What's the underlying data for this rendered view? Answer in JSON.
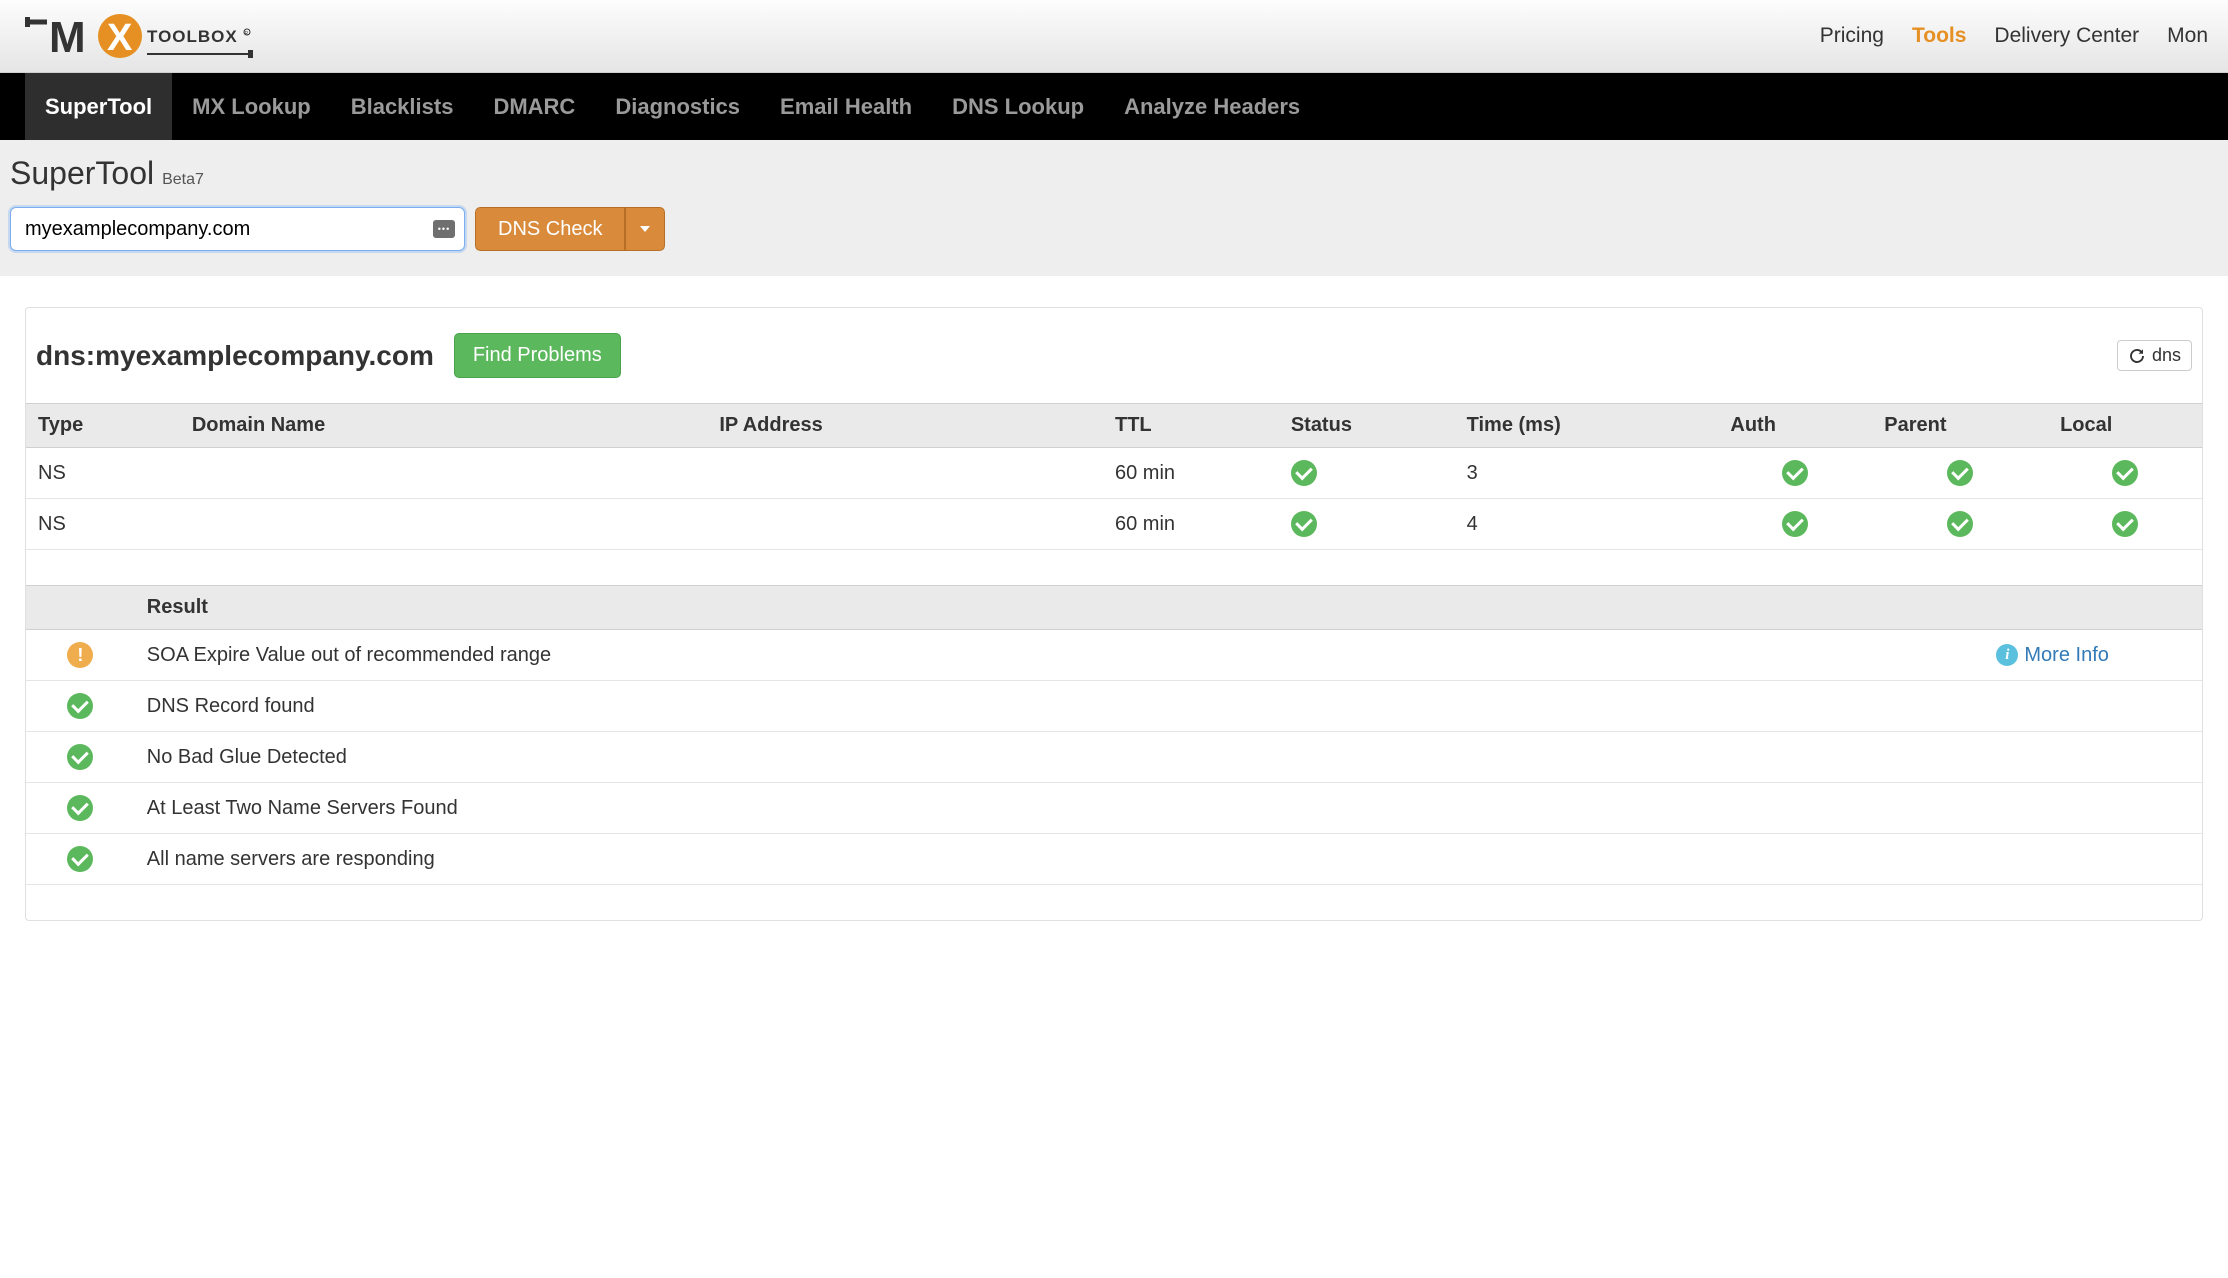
{
  "top_nav": {
    "pricing": "Pricing",
    "tools": "Tools",
    "delivery_center": "Delivery Center",
    "more": "Mon"
  },
  "black_nav": {
    "supertool": "SuperTool",
    "mx_lookup": "MX Lookup",
    "blacklists": "Blacklists",
    "dmarc": "DMARC",
    "diagnostics": "Diagnostics",
    "email_health": "Email Health",
    "dns_lookup": "DNS Lookup",
    "analyze_headers": "Analyze Headers"
  },
  "tool": {
    "title": "SuperTool",
    "beta": "Beta7",
    "input_value": "myexamplecompany.com",
    "action_label": "DNS Check"
  },
  "result": {
    "title": "dns:myexamplecompany.com",
    "find_problems": "Find Problems",
    "refresh_label": "dns"
  },
  "records_table": {
    "headers": {
      "type": "Type",
      "domain_name": "Domain Name",
      "ip": "IP Address",
      "ttl": "TTL",
      "status": "Status",
      "time": "Time (ms)",
      "auth": "Auth",
      "parent": "Parent",
      "local": "Local"
    },
    "rows": [
      {
        "type": "NS",
        "domain": "",
        "ip": "",
        "ttl": "60 min",
        "status": "ok",
        "time": "3",
        "auth": "ok",
        "parent": "ok",
        "local": "ok"
      },
      {
        "type": "NS",
        "domain": "",
        "ip": "",
        "ttl": "60 min",
        "status": "ok",
        "time": "4",
        "auth": "ok",
        "parent": "ok",
        "local": "ok"
      }
    ]
  },
  "results_table": {
    "headers": {
      "blank": "",
      "result": "Result",
      "action": ""
    },
    "rows": [
      {
        "status": "warn",
        "text": "SOA Expire Value out of recommended range",
        "more": "More Info"
      },
      {
        "status": "ok",
        "text": "DNS Record found",
        "more": ""
      },
      {
        "status": "ok",
        "text": "No Bad Glue Detected",
        "more": ""
      },
      {
        "status": "ok",
        "text": "At Least Two Name Servers Found",
        "more": ""
      },
      {
        "status": "ok",
        "text": "All name servers are responding",
        "more": ""
      }
    ]
  }
}
